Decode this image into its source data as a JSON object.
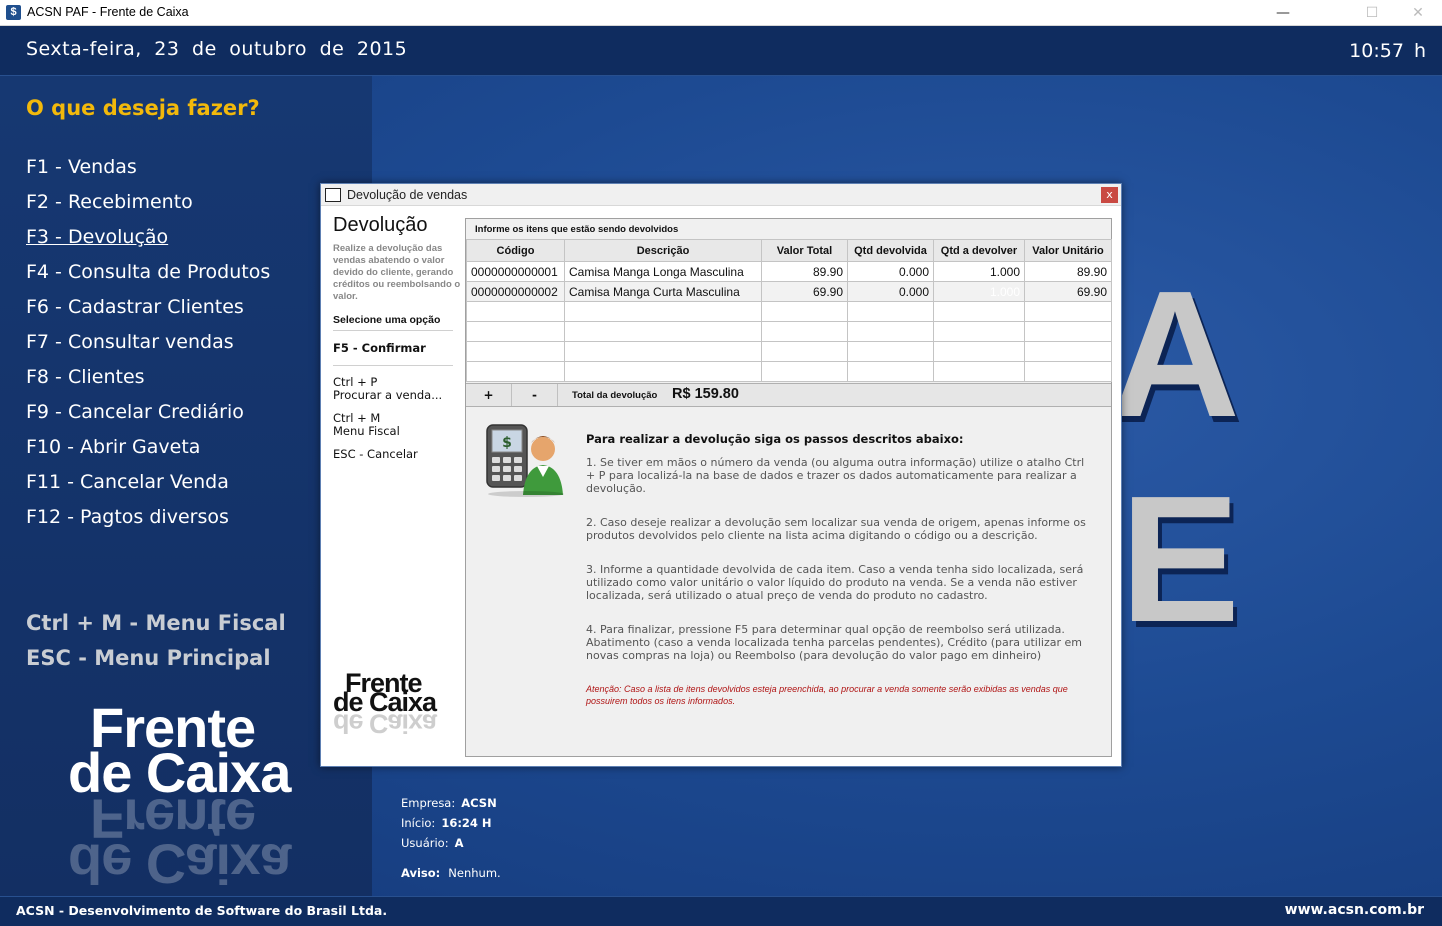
{
  "window": {
    "title": "ACSN PAF - Frente de Caixa",
    "icon_glyph": "$",
    "min_glyph": "—",
    "max_glyph": "☐",
    "close_glyph": "✕"
  },
  "header": {
    "date": "Sexta-feira, 23 de outubro de 2015",
    "time": "10:57 h"
  },
  "sidebar": {
    "question": "O que deseja fazer?",
    "items": [
      {
        "label": "F1 - Vendas"
      },
      {
        "label": "F2 - Recebimento"
      },
      {
        "label": "F3 - Devolução"
      },
      {
        "label": "F4 - Consulta de Produtos"
      },
      {
        "label": "F6 - Cadastrar Clientes"
      },
      {
        "label": "F7 - Consultar vendas"
      },
      {
        "label": "F8 - Clientes"
      },
      {
        "label": "F9 - Cancelar Crediário"
      },
      {
        "label": "F10 - Abrir Gaveta"
      },
      {
        "label": "F11 - Cancelar Venda"
      },
      {
        "label": "F12 - Pagtos diversos"
      }
    ],
    "active_index": 2,
    "shortcuts": [
      "Ctrl + M - Menu Fiscal",
      "ESC - Menu Principal"
    ]
  },
  "brand": {
    "line1": "Frente",
    "line2": "de Caixa"
  },
  "background_letters": [
    "A",
    "E"
  ],
  "info": {
    "empresa_label": "Empresa:",
    "empresa_value": "ACSN",
    "inicio_label": "Início:",
    "inicio_value": "16:24 H",
    "usuario_label": "Usuário:",
    "usuario_value": "A",
    "aviso_label": "Aviso:",
    "aviso_value": "Nenhum."
  },
  "footer": {
    "company": "ACSN - Desenvolvimento de Software do Brasil Ltda.",
    "url": "www.acsn.com.br"
  },
  "dialog": {
    "title": "Devolução de vendas",
    "close_glyph": "x",
    "heading": "Devolução",
    "description": "Realize a devolução das vendas abatendo o valor devido do cliente, gerando créditos ou reembolsando o valor.",
    "select_label": "Selecione uma opção",
    "confirm": "F5 - Confirmar",
    "cmd_search_key": "Ctrl + P",
    "cmd_search_label": "Procurar a venda...",
    "cmd_fiscal_key": "Ctrl + M",
    "cmd_fiscal_label": "Menu Fiscal",
    "cmd_cancel": "ESC - Cancelar",
    "logo_line1": "Frente",
    "logo_line2": "de Caixa",
    "grid_title": "Informe os itens que estão sendo devolvidos",
    "columns": [
      "Código",
      "Descrição",
      "Valor Total",
      "Qtd devolvida",
      "Qtd a devolver",
      "Valor Unitário"
    ],
    "rows": [
      [
        "0000000000001",
        "Camisa Manga Longa Masculina",
        "89.90",
        "0.000",
        "1.000",
        "89.90"
      ],
      [
        "0000000000002",
        "Camisa Manga Curta Masculina",
        "69.90",
        "0.000",
        "1.000",
        "69.90"
      ]
    ],
    "add_label": "+",
    "remove_label": "-",
    "total_label": "Total da devolução",
    "total_value": "R$ 159.80",
    "help_title": "Para realizar a devolução siga os passos descritos abaixo:",
    "help_steps": [
      "1. Se tiver em mãos o número da venda (ou alguma outra informação) utilize o atalho Ctrl + P para localizá-la na base de dados e trazer os dados automaticamente para realizar a devolução.",
      "2. Caso deseje realizar a devolução sem localizar sua venda de origem, apenas informe os produtos devolvidos pelo cliente na lista acima digitando o código ou a descrição.",
      "3. Informe a quantidade devolvida de cada item. Caso a venda tenha sido localizada, será utilizado como valor unitário o valor líquido do produto na venda. Se a venda não estiver localizada, será utilizado o atual preço de venda do produto no cadastro.",
      "4. Para finalizar, pressione F5 para determinar qual opção de reembolso será utilizada. Abatimento (caso a venda localizada tenha parcelas pendentes), Crédito (para utilizar em novas compras na loja) ou Reembolso (para devolução do valor pago em dinheiro)"
    ],
    "warning": "Atenção: Caso a lista de itens devolvidos esteja preenchida, ao procurar a venda somente serão exibidas as vendas que possuirem todos os itens informados."
  },
  "colors": {
    "accent": "#f2b90b",
    "selection": "#3399ff",
    "warning": "#b01515",
    "app_blue": "#1d4a92"
  }
}
